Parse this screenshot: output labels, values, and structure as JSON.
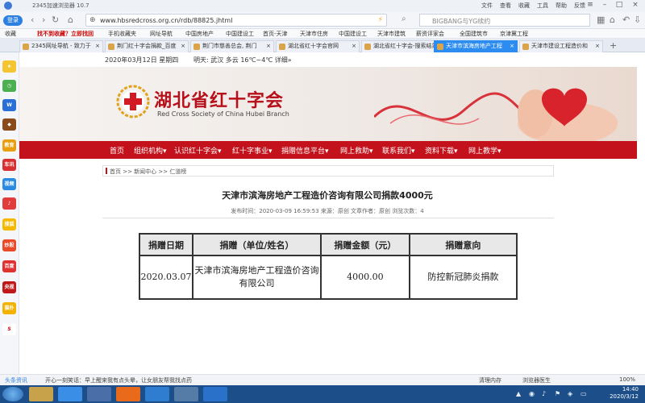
{
  "window": {
    "title": "2345加速浏览器 10.7",
    "menu": [
      "文件",
      "查看",
      "收藏",
      "工具",
      "帮助",
      "反馈"
    ],
    "controls": [
      "≡",
      "–",
      "□",
      "×"
    ]
  },
  "navbar": {
    "login": "登录",
    "url": "www.hbsredcross.org.cn/rdb/88825.jhtml",
    "search_value": "BIGBANG与YG续约"
  },
  "bookmarks": [
    "收藏",
    "找不到收藏？立即找回",
    "手机收藏夹",
    "网址导航",
    "中国房地产",
    "中国建设工",
    "首页-天津",
    "天津市住房",
    "中国建设工",
    "天津市建筑",
    "薪资评家会",
    "全国建筑市",
    "京津冀工程"
  ],
  "tabs": [
    {
      "label": "2345网址导航 - 致力于",
      "active": false
    },
    {
      "label": "荆门红十字会捐款_百度",
      "active": false
    },
    {
      "label": "荆门市慈善总会, 荆门",
      "active": false
    },
    {
      "label": "湖北省红十字会官网",
      "active": false
    },
    {
      "label": "湖北省红十字会-搜索结果",
      "active": false
    },
    {
      "label": "天津市滨海房地产工程",
      "active": true
    },
    {
      "label": "天津市建设工程造价和",
      "active": false
    }
  ],
  "sidebar_icons": [
    "star-icon",
    "clock-icon",
    "word-icon",
    "game-icon",
    "教育",
    "车讯",
    "视频",
    "music-icon",
    "搜狐",
    "炒股",
    "百度",
    "央视",
    "猫扑",
    "sina-icon"
  ],
  "date_bar": {
    "date": "2020年03月12日  星期四",
    "weather": "明天: 武汉  多云  16℃~4℃  详细»"
  },
  "banner": {
    "org_name": "湖北省红十字会",
    "org_en": "Red Cross Society of China Hubei Branch"
  },
  "menu": [
    "首页",
    "组织机构▾",
    "认识红十字会▾",
    "红十字事业▾",
    "捐赠信息平台▾",
    "网上救助▾",
    "联系我们▾",
    "资料下载▾",
    "网上教学▾"
  ],
  "breadcrumb": "首页 >> 新闻中心 >> 仁道榜",
  "article": {
    "title": "天津市滨海房地产工程造价咨询有限公司捐款4000元",
    "meta": "发布时间：2020-03-09 16:59:53  来源：原创  文章作者：原创  浏览次数：4"
  },
  "donation_table": {
    "headers": [
      "捐赠日期",
      "捐赠（单位/姓名）",
      "捐赠金额（元）",
      "捐赠意向"
    ],
    "rows": [
      [
        "2020.03.07",
        "天津市滨海房地产工程造价咨询有限公司",
        "4000.00",
        "防控新冠肺炎捐款"
      ]
    ]
  },
  "statusbar": {
    "news_label": "头条资讯",
    "news_text": "开心一刻笑话：早上醒来我有点头晕，让女朋友帮我找点药",
    "clean": "清理内存",
    "doctor": "浏览器医生",
    "zoom": "100%"
  },
  "taskbar": {
    "time": "14:40",
    "date": "2020/3/12"
  }
}
